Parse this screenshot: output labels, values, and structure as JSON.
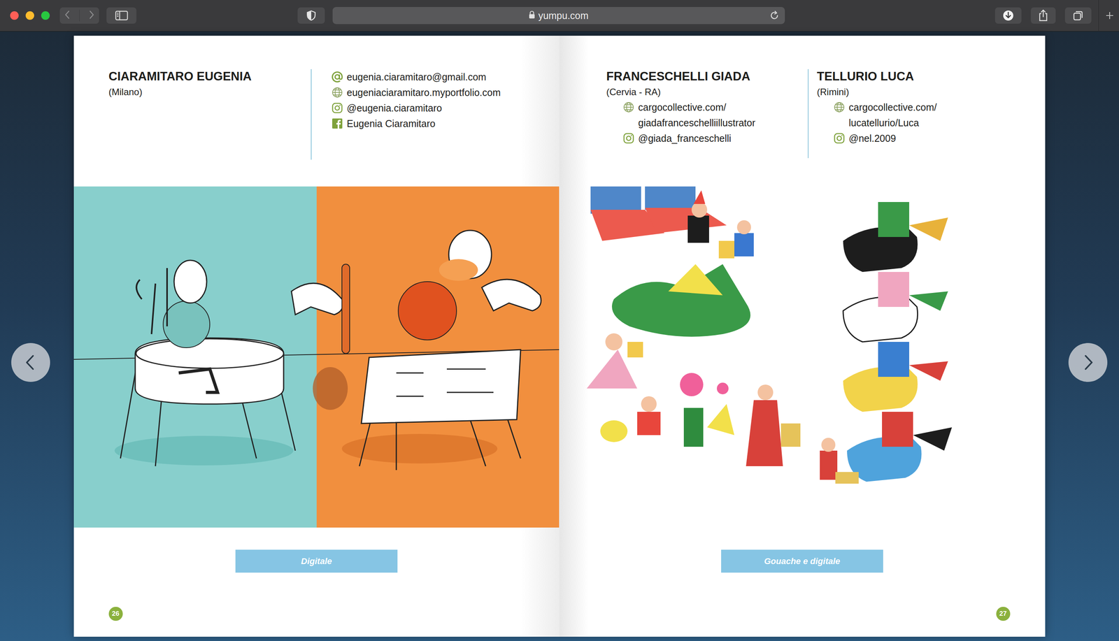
{
  "browser": {
    "address": "yumpu.com"
  },
  "pages": [
    {
      "number": "26",
      "technique": "Digitale",
      "artists": [
        {
          "name": "CIARAMITARO EUGENIA",
          "city": "(Milano)",
          "contacts": [
            {
              "kind": "email",
              "lines": [
                "eugenia.ciaramitaro@gmail.com"
              ]
            },
            {
              "kind": "web",
              "lines": [
                "eugeniaciaramitaro.myportfolio.com"
              ]
            },
            {
              "kind": "instagram",
              "lines": [
                "@eugenia.ciaramitaro"
              ]
            },
            {
              "kind": "facebook",
              "lines": [
                "Eugenia Ciaramitaro"
              ]
            }
          ]
        }
      ]
    },
    {
      "number": "27",
      "technique": "Gouache e digitale",
      "artists": [
        {
          "name": "FRANCESCHELLI GIADA",
          "city": "(Cervia - RA)",
          "contacts": [
            {
              "kind": "web",
              "lines": [
                "cargocollective.com/",
                "giadafranceschelliillustrator"
              ]
            },
            {
              "kind": "instagram",
              "lines": [
                "@giada_franceschelli"
              ]
            }
          ]
        },
        {
          "name": "TELLURIO LUCA",
          "city": "(Rimini)",
          "contacts": [
            {
              "kind": "web",
              "lines": [
                "cargocollective.com/",
                "lucatellurio/Luca"
              ]
            },
            {
              "kind": "instagram",
              "lines": [
                "@nel.2009"
              ]
            }
          ]
        }
      ]
    }
  ]
}
